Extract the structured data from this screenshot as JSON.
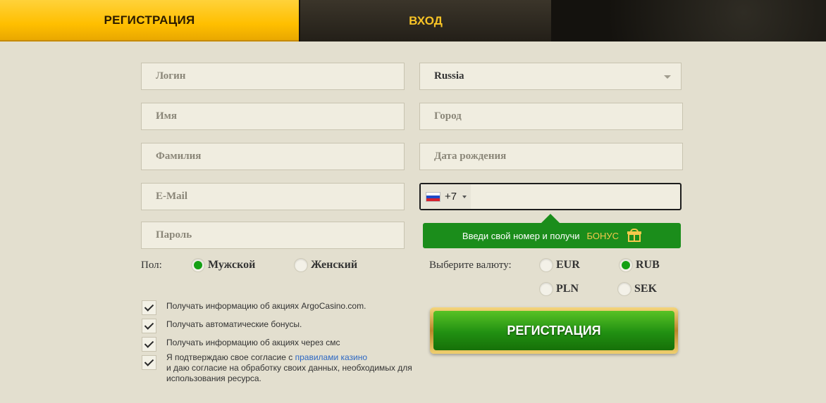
{
  "tabs": {
    "register": "РЕГИСТРАЦИЯ",
    "login": "ВХОД"
  },
  "fields": {
    "login_placeholder": "Логин",
    "name_placeholder": "Имя",
    "surname_placeholder": "Фамилия",
    "email_placeholder": "E-Mail",
    "password_placeholder": "Пароль",
    "city_placeholder": "Город",
    "birthdate_placeholder": "Дата рождения"
  },
  "country": {
    "selected": "Russia"
  },
  "phone": {
    "code": "+7",
    "flag": "russia-flag-icon"
  },
  "bonus": {
    "text": "Введи свой номер и получи",
    "highlight": "БОНУС",
    "icon": "gift-icon",
    "highlight_color": "#f4c84b"
  },
  "gender": {
    "label": "Пол:",
    "male": "Мужской",
    "female": "Женский",
    "selected": "male"
  },
  "currency": {
    "label": "Выберите валюту:",
    "options": [
      "EUR",
      "RUB",
      "PLN",
      "SEK"
    ],
    "selected": "RUB"
  },
  "checkboxes": {
    "promo": "Получать информацию об акциях ArgoCasino.com.",
    "auto_bonus": "Получать автоматические бонусы.",
    "sms": "Получать информацию об акциях через смс",
    "agree_prefix": "Я подтверждаю свое согласие с ",
    "agree_link": "правилами казино",
    "agree_line2": "и даю согласие на обработку своих данных, необходимых для",
    "agree_line3": "использования ресурса."
  },
  "submit_label": "РЕГИСТРАЦИЯ",
  "colors": {
    "accent_yellow": "#ffbf00",
    "accent_green": "#1b8d1b",
    "link_blue": "#2d68c4",
    "background": "#e3dfcf"
  }
}
